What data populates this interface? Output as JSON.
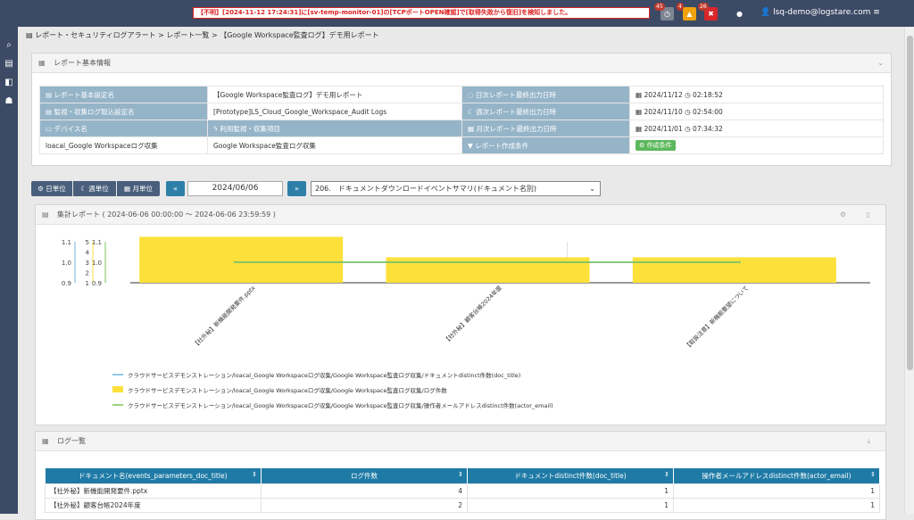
{
  "topbar": {
    "alert": "【不明】[2024-11-12 17:24:31]に[sv-temp-monitor-01]の[TCPポートOPEN確認]で[取得失敗から復旧]を検知しました。",
    "badges": [
      {
        "count": "45",
        "color": "#7d8590",
        "icon": "clock-icon"
      },
      {
        "count": "4",
        "color": "#f0a30a",
        "icon": "warning-icon"
      },
      {
        "count": "26",
        "color": "#d9262b",
        "icon": "error-icon"
      }
    ],
    "user": "lsq-demo@logstare.com"
  },
  "breadcrumb": "レポート・セキュリティログアラート > レポート一覧 > 【Google Workspace監査ログ】デモ用レポート",
  "info": {
    "title": "レポート基本情報",
    "rows": [
      {
        "l1": "レポート基本設定名",
        "v1": "【Google Workspace監査ログ】デモ用レポート",
        "l2": "日次レポート最終出力日時",
        "v2": "2024/11/12",
        "t2": "02:18:52"
      },
      {
        "l1": "監視・収集ログ取込設定名",
        "v1": "[Prototype]LS_Cloud_Google_Workspace_Audit Logs",
        "l2": "週次レポート最終出力日時",
        "v2": "2024/11/10",
        "t2": "02:54:00"
      },
      {
        "l1": "デバイス名",
        "v1": "利用監視・収集項目",
        "l2": "月次レポート最終出力日時",
        "v2": "2024/11/01",
        "t2": "07:34:32"
      },
      {
        "l1": "loacal_Google Workspaceログ収集",
        "v1": "Google Workspace監査ログ収集",
        "l2": "レポート作成条件",
        "v2": "作成条件"
      }
    ]
  },
  "controls": {
    "day": "日単位",
    "week": "週単位",
    "month": "月単位",
    "date": "2024/06/06",
    "report": "206.　ドキュメントダウンロードイベントサマリ(ドキュメント名別)"
  },
  "summary": {
    "title": "集計レポート ( 2024-06-06 00:00:00 ～ 2024-06-06 23:59:59 )"
  },
  "chart_data": {
    "type": "bar",
    "categories": [
      "【社外秘】新機能開発要件.pptx",
      "【社外秘】顧客台帳2024年度",
      "【取扱注意】新機能要望について"
    ],
    "series": [
      {
        "name": "クラウドサービスデモンストレーション/loacal_Google Workspaceログ収集/Google Workspace監査ログ収集/ドキュメントdistinct件数(doc_title)",
        "type": "line",
        "color": "#6fb4e0",
        "values": [
          1,
          1,
          1
        ]
      },
      {
        "name": "クラウドサービスデモンストレーション/loacal_Google Workspaceログ収集/Google Workspace監査ログ収集/ログ件数",
        "type": "bar",
        "color": "#fde03a",
        "values": [
          4,
          2,
          2
        ]
      },
      {
        "name": "クラウドサービスデモンストレーション/loacal_Google Workspaceログ収集/Google Workspace監査ログ収集/操作者メールアドレスdistinct件数(actor_email)",
        "type": "line",
        "color": "#7cc35a",
        "values": [
          1,
          1,
          1
        ]
      }
    ],
    "axes": [
      {
        "ticks": [
          "1.1",
          "1.0",
          "0.9"
        ],
        "color": "#6fb4e0"
      },
      {
        "ticks": [
          "5",
          "4",
          "3",
          "2",
          "1"
        ],
        "color": "#fde03a"
      },
      {
        "ticks": [
          "1.1",
          "1.0",
          "0.9"
        ],
        "color": "#7cc35a"
      }
    ],
    "legend_position": "bottom"
  },
  "log": {
    "title": "ログ一覧",
    "headers": [
      "ドキュメント名(events_parameters_doc_title)",
      "ログ件数",
      "ドキュメントdistinct件数(doc_title)",
      "操作者メールアドレスdistinct件数(actor_email)"
    ],
    "rows": [
      [
        "【社外秘】新機能開発要件.pptx",
        "4",
        "1",
        "1"
      ],
      [
        "【社外秘】顧客台帳2024年度",
        "2",
        "1",
        "1"
      ]
    ]
  }
}
